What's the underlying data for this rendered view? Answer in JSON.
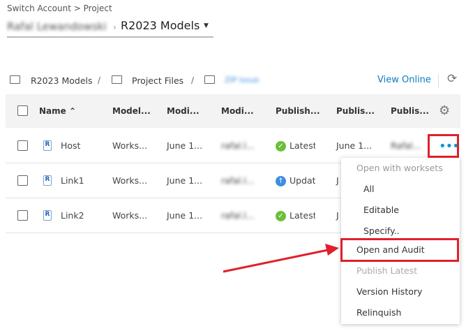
{
  "header": {
    "switch_account": "Switch Account > Project",
    "account": "Rafal Lewandowski",
    "sep": "›",
    "project": "R2023 Models"
  },
  "folders": {
    "items": [
      "R2023 Models",
      "Project Files",
      "ZIP Issue"
    ],
    "sep": "/",
    "view_online": "View Online"
  },
  "table": {
    "columns": [
      "Name",
      "Model...",
      "Modi...",
      "Modi...",
      "Publish...",
      "Publis...",
      "Publis..."
    ],
    "rows": [
      {
        "name": "Host",
        "model": "Works...",
        "modified": "June 1...",
        "modified_by": "rafal.l...",
        "status": "Latest",
        "status_type": "latest",
        "published": "June 1...",
        "published_by": "Rafal..."
      },
      {
        "name": "Link1",
        "model": "Works...",
        "modified": "June 1...",
        "modified_by": "rafal.l...",
        "status": "Updat",
        "status_type": "update",
        "published": "J"
      },
      {
        "name": "Link2",
        "model": "Works...",
        "modified": "June 1...",
        "modified_by": "rafal.l...",
        "status": "Latest",
        "status_type": "latest",
        "published": "J"
      }
    ],
    "file_badge": "R"
  },
  "menu": {
    "header": "Open with worksets",
    "items": [
      "All",
      "Editable",
      "Specify..",
      "Open and Audit",
      "Publish Latest",
      "Version History",
      "Relinquish"
    ]
  },
  "colors": {
    "accent": "#0696d7",
    "highlight": "#e0202a",
    "latest": "#6bbf3a",
    "update": "#3c8ee0"
  }
}
